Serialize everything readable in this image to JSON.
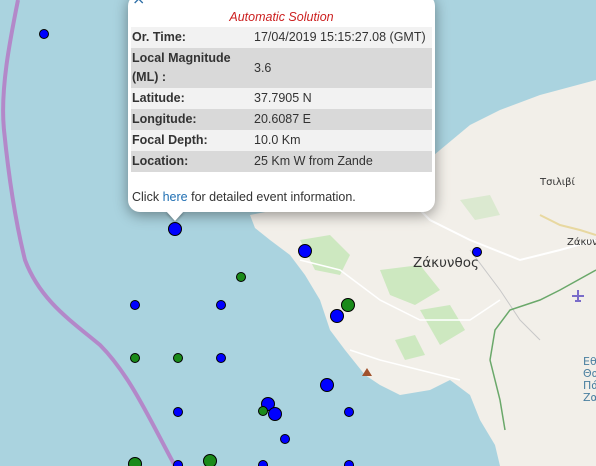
{
  "map": {
    "places": {
      "zakynthos": "Ζάκυνθος",
      "tsilivi": "Τσιλιβί",
      "zakyn_short": "Ζάκυν"
    },
    "sea_label_lines": [
      "Εθ",
      "Θαλ",
      "Πά",
      "Ζακ"
    ],
    "colors": {
      "sea": "#aad3df",
      "land": "#f2efe9",
      "boundary": "#b388c9",
      "marker_blue": "#0000ff",
      "marker_green": "#1a8a1a"
    }
  },
  "popup": {
    "close_symbol": "×",
    "heading": "Automatic Solution",
    "rows": [
      {
        "label": "Or. Time:",
        "value": "17/04/2019 15:15:27.08 (GMT)"
      },
      {
        "label": "Local Magnitude (ML) :",
        "value": "3.6"
      },
      {
        "label": "Latitude:",
        "value": "37.7905 N"
      },
      {
        "label": "Longitude:",
        "value": "20.6087 E"
      },
      {
        "label": "Focal Depth:",
        "value": "10.0 Km"
      },
      {
        "label": "Location:",
        "value": "25 Km W from Zande"
      }
    ],
    "footer": {
      "prefix": "Click",
      "link_text": "here",
      "suffix": "for detailed event information."
    }
  }
}
